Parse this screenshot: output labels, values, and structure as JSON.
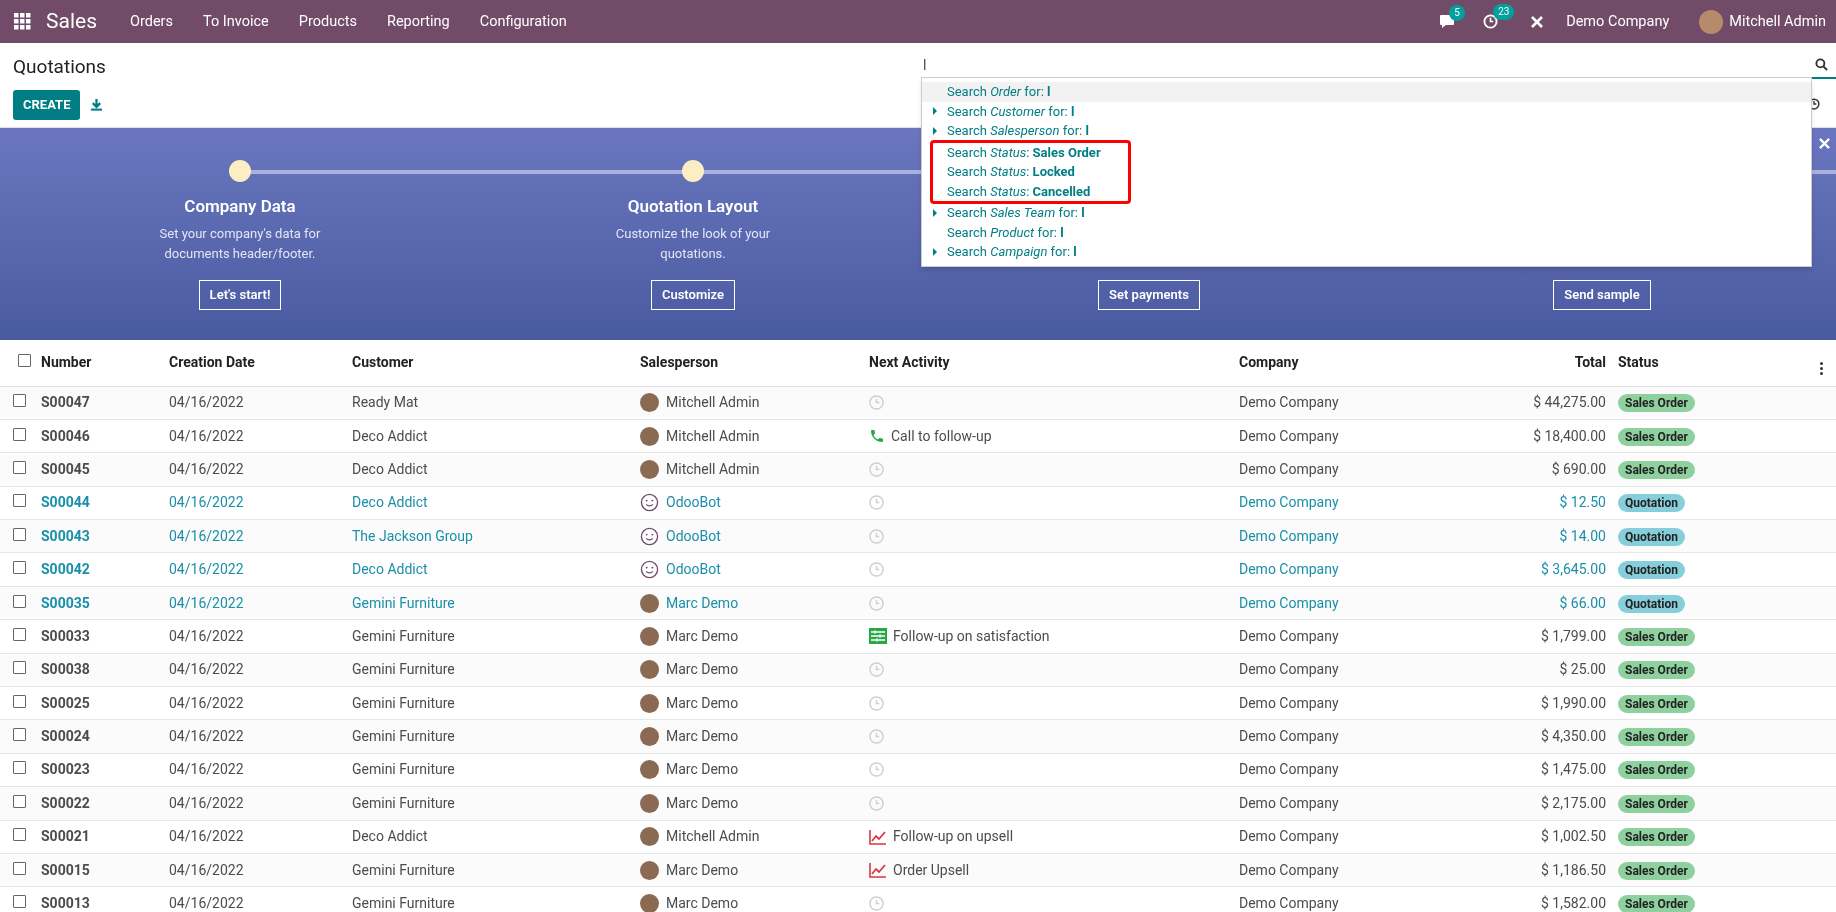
{
  "navbar": {
    "app": "Sales",
    "menu": [
      "Orders",
      "To Invoice",
      "Products",
      "Reporting",
      "Configuration"
    ],
    "messages_count": "5",
    "activities_count": "23",
    "company": "Demo Company",
    "user": "Mitchell Admin"
  },
  "control_panel": {
    "title": "Quotations",
    "create_button": "CREATE",
    "search": {
      "value": "l"
    }
  },
  "search_dropdown": [
    {
      "text": "Search *Order* for: **l**",
      "expandable": false,
      "selected": true,
      "annotated": false
    },
    {
      "text": "Search *Customer* for: **l**",
      "expandable": true,
      "selected": false,
      "annotated": false
    },
    {
      "text": "Search *Salesperson* for: **l**",
      "expandable": true,
      "selected": false,
      "annotated": false
    },
    {
      "text": "Search *Status*: **Sales Order**",
      "expandable": false,
      "selected": false,
      "annotated": true
    },
    {
      "text": "Search *Status*: **Locked**",
      "expandable": false,
      "selected": false,
      "annotated": true
    },
    {
      "text": "Search *Status*: **Cancelled**",
      "expandable": false,
      "selected": false,
      "annotated": true
    },
    {
      "text": "Search *Sales Team* for: **l**",
      "expandable": true,
      "selected": false,
      "annotated": false
    },
    {
      "text": "Search *Product* for: **l**",
      "expandable": false,
      "selected": false,
      "annotated": false
    },
    {
      "text": "Search *Campaign* for: **l**",
      "expandable": true,
      "selected": false,
      "annotated": false
    }
  ],
  "onboarding": [
    {
      "title": "Company Data",
      "description": "Set your company's data for documents header/footer.",
      "button": "Let's start!"
    },
    {
      "title": "Quotation Layout",
      "description": "Customize the look of your quotations.",
      "button": "Customize"
    },
    {
      "button": "Set payments"
    },
    {
      "button": "Send sample"
    }
  ],
  "table": {
    "all_checked": false,
    "columns": [
      "Number",
      "Creation Date",
      "Customer",
      "Salesperson",
      "Next Activity",
      "Company",
      "Total",
      "Status"
    ],
    "rows": [
      {
        "checked": false,
        "number": "S00047",
        "date": "04/16/2022",
        "customer": "Ready Mat",
        "salesperson": {
          "name": "Mitchell Admin",
          "kind": "photo"
        },
        "activity": {
          "kind": "none"
        },
        "company": "Demo Company",
        "total": "$ 44,275.00",
        "status": {
          "kind": "sale",
          "label": "Sales Order"
        }
      },
      {
        "checked": false,
        "number": "S00046",
        "date": "04/16/2022",
        "customer": "Deco Addict",
        "salesperson": {
          "name": "Mitchell Admin",
          "kind": "photo"
        },
        "activity": {
          "kind": "call",
          "label": "Call to follow-up"
        },
        "company": "Demo Company",
        "total": "$ 18,400.00",
        "status": {
          "kind": "sale",
          "label": "Sales Order"
        }
      },
      {
        "checked": false,
        "number": "S00045",
        "date": "04/16/2022",
        "customer": "Deco Addict",
        "salesperson": {
          "name": "Mitchell Admin",
          "kind": "photo"
        },
        "activity": {
          "kind": "none"
        },
        "company": "Demo Company",
        "total": "$ 690.00",
        "status": {
          "kind": "sale",
          "label": "Sales Order"
        }
      },
      {
        "checked": false,
        "number": "S00044",
        "date": "04/16/2022",
        "customer": "Deco Addict",
        "salesperson": {
          "name": "OdooBot",
          "kind": "bot"
        },
        "activity": {
          "kind": "none"
        },
        "company": "Demo Company",
        "total": "$ 12.50",
        "status": {
          "kind": "draft",
          "label": "Quotation"
        }
      },
      {
        "checked": false,
        "number": "S00043",
        "date": "04/16/2022",
        "customer": "The Jackson Group",
        "salesperson": {
          "name": "OdooBot",
          "kind": "bot"
        },
        "activity": {
          "kind": "none"
        },
        "company": "Demo Company",
        "total": "$ 14.00",
        "status": {
          "kind": "draft",
          "label": "Quotation"
        }
      },
      {
        "checked": false,
        "number": "S00042",
        "date": "04/16/2022",
        "customer": "Deco Addict",
        "salesperson": {
          "name": "OdooBot",
          "kind": "bot"
        },
        "activity": {
          "kind": "none"
        },
        "company": "Demo Company",
        "total": "$ 3,645.00",
        "status": {
          "kind": "draft",
          "label": "Quotation"
        }
      },
      {
        "checked": false,
        "number": "S00035",
        "date": "04/16/2022",
        "customer": "Gemini Furniture",
        "salesperson": {
          "name": "Marc Demo",
          "kind": "photo"
        },
        "activity": {
          "kind": "none"
        },
        "company": "Demo Company",
        "total": "$ 66.00",
        "status": {
          "kind": "draft",
          "label": "Quotation"
        }
      },
      {
        "checked": false,
        "number": "S00033",
        "date": "04/16/2022",
        "customer": "Gemini Furniture",
        "salesperson": {
          "name": "Marc Demo",
          "kind": "photo"
        },
        "activity": {
          "kind": "todo",
          "label": "Follow-up on satisfaction"
        },
        "company": "Demo Company",
        "total": "$ 1,799.00",
        "status": {
          "kind": "sale",
          "label": "Sales Order"
        }
      },
      {
        "checked": false,
        "number": "S00038",
        "date": "04/16/2022",
        "customer": "Gemini Furniture",
        "salesperson": {
          "name": "Marc Demo",
          "kind": "photo"
        },
        "activity": {
          "kind": "none"
        },
        "company": "Demo Company",
        "total": "$ 25.00",
        "status": {
          "kind": "sale",
          "label": "Sales Order"
        }
      },
      {
        "checked": false,
        "number": "S00025",
        "date": "04/16/2022",
        "customer": "Gemini Furniture",
        "salesperson": {
          "name": "Marc Demo",
          "kind": "photo"
        },
        "activity": {
          "kind": "none"
        },
        "company": "Demo Company",
        "total": "$ 1,990.00",
        "status": {
          "kind": "sale",
          "label": "Sales Order"
        }
      },
      {
        "checked": false,
        "number": "S00024",
        "date": "04/16/2022",
        "customer": "Gemini Furniture",
        "salesperson": {
          "name": "Marc Demo",
          "kind": "photo"
        },
        "activity": {
          "kind": "none"
        },
        "company": "Demo Company",
        "total": "$ 4,350.00",
        "status": {
          "kind": "sale",
          "label": "Sales Order"
        }
      },
      {
        "checked": false,
        "number": "S00023",
        "date": "04/16/2022",
        "customer": "Gemini Furniture",
        "salesperson": {
          "name": "Marc Demo",
          "kind": "photo"
        },
        "activity": {
          "kind": "none"
        },
        "company": "Demo Company",
        "total": "$ 1,475.00",
        "status": {
          "kind": "sale",
          "label": "Sales Order"
        }
      },
      {
        "checked": false,
        "number": "S00022",
        "date": "04/16/2022",
        "customer": "Gemini Furniture",
        "salesperson": {
          "name": "Marc Demo",
          "kind": "photo"
        },
        "activity": {
          "kind": "none"
        },
        "company": "Demo Company",
        "total": "$ 2,175.00",
        "status": {
          "kind": "sale",
          "label": "Sales Order"
        }
      },
      {
        "checked": false,
        "number": "S00021",
        "date": "04/16/2022",
        "customer": "Deco Addict",
        "salesperson": {
          "name": "Mitchell Admin",
          "kind": "photo"
        },
        "activity": {
          "kind": "upsell",
          "label": "Follow-up on upsell"
        },
        "company": "Demo Company",
        "total": "$ 1,002.50",
        "status": {
          "kind": "sale",
          "label": "Sales Order"
        }
      },
      {
        "checked": false,
        "number": "S00015",
        "date": "04/16/2022",
        "customer": "Gemini Furniture",
        "salesperson": {
          "name": "Marc Demo",
          "kind": "photo"
        },
        "activity": {
          "kind": "upsell",
          "label": "Order Upsell"
        },
        "company": "Demo Company",
        "total": "$ 1,186.50",
        "status": {
          "kind": "sale",
          "label": "Sales Order"
        }
      },
      {
        "checked": false,
        "number": "S00013",
        "date": "04/16/2022",
        "customer": "Gemini Furniture",
        "salesperson": {
          "name": "Marc Demo",
          "kind": "photo"
        },
        "activity": {
          "kind": "none"
        },
        "company": "Demo Company",
        "total": "$ 1,582.00",
        "status": {
          "kind": "sale",
          "label": "Sales Order"
        }
      }
    ]
  }
}
